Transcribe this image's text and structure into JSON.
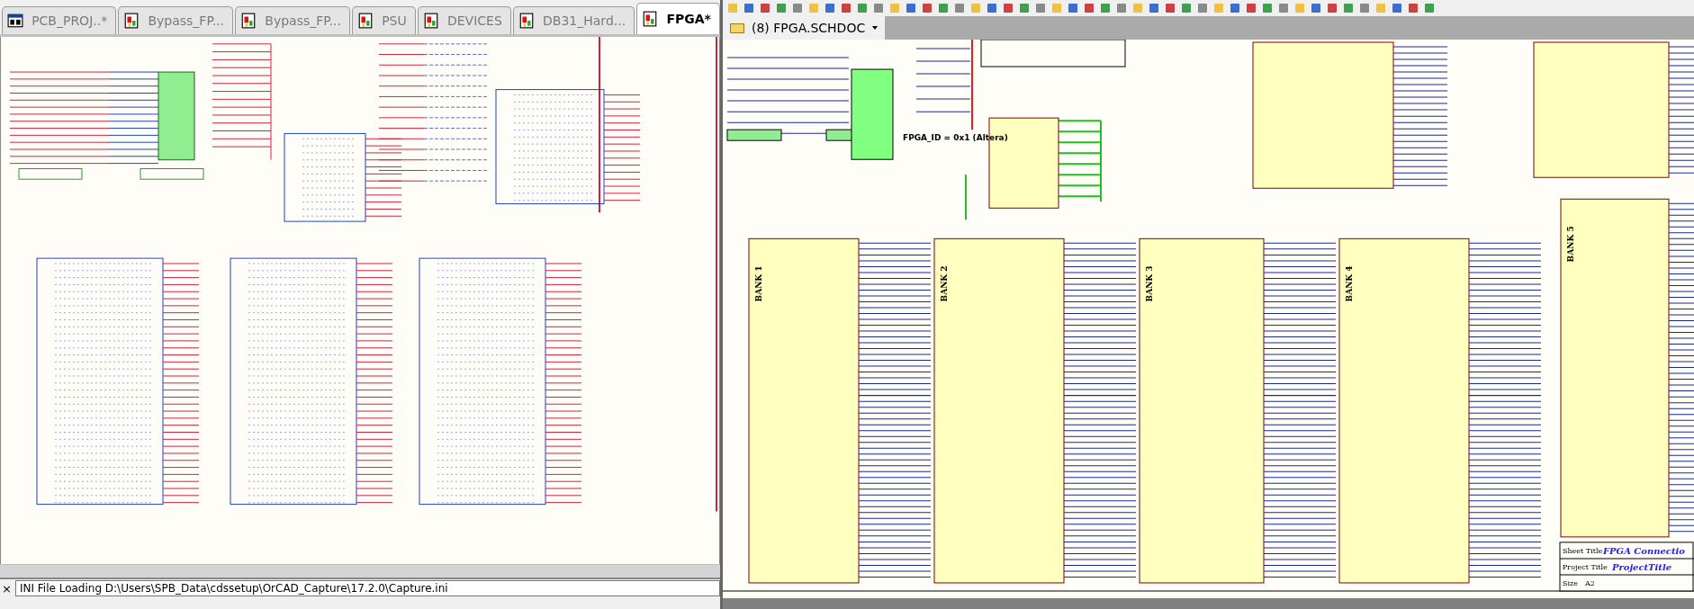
{
  "left_tabs": [
    {
      "label": "PCB_PROJ..*",
      "kind": "project",
      "selected": false
    },
    {
      "label": "Bypass_FP...",
      "kind": "schematic",
      "selected": false
    },
    {
      "label": "Bypass_FP...",
      "kind": "schematic",
      "selected": false
    },
    {
      "label": "PSU",
      "kind": "schematic",
      "selected": false
    },
    {
      "label": "DEVICES",
      "kind": "schematic",
      "selected": false
    },
    {
      "label": "DB31_Hard...",
      "kind": "schematic",
      "selected": false
    },
    {
      "label": "FPGA*",
      "kind": "schematic",
      "selected": true
    }
  ],
  "document_tab": {
    "label": "(8) FPGA.SCHDOC"
  },
  "schematic": {
    "id_note": "FPGA_ID = 0x1 (Altera)",
    "banks": [
      "BANK 1",
      "BANK 2",
      "BANK 3",
      "BANK 4",
      "BANK 5"
    ],
    "title_block": {
      "sheet_title_label": "Sheet Title",
      "sheet_title": "FPGA Connectio",
      "project_title_label": "Project Title",
      "project_title": "ProjectTitle",
      "size_label": "Size",
      "size": "A2"
    }
  },
  "status_bar": {
    "close_glyph": "×",
    "message": "INI File Loading D:\\Users\\SPB_Data\\cdssetup\\OrCAD_Capture\\17.2.0\\Capture.ini"
  }
}
